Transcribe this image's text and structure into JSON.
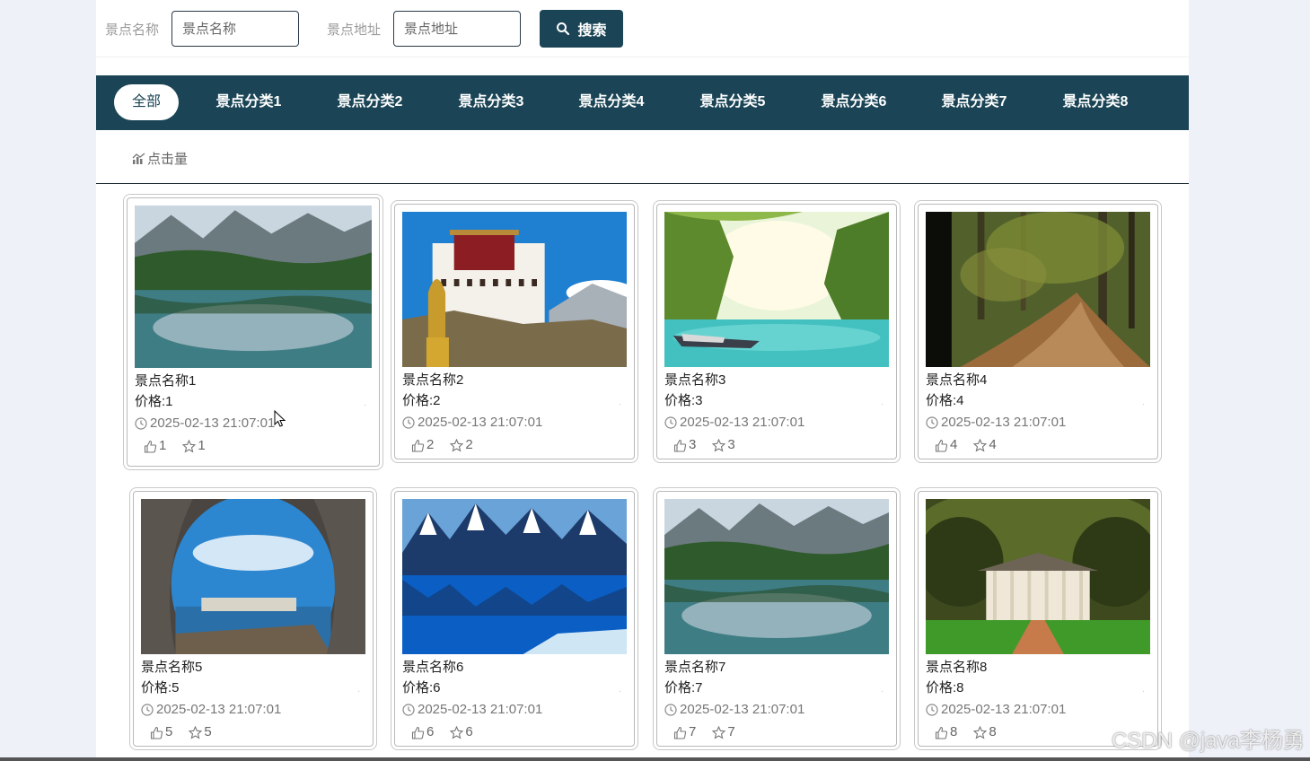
{
  "search": {
    "name_label": "景点名称",
    "name_placeholder": "景点名称",
    "address_label": "景点地址",
    "address_placeholder": "景点地址",
    "button_label": "搜索"
  },
  "categories": [
    "全部",
    "景点分类1",
    "景点分类2",
    "景点分类3",
    "景点分类4",
    "景点分类5",
    "景点分类6",
    "景点分类7",
    "景点分类8"
  ],
  "sort": {
    "label": "点击量"
  },
  "cards": [
    {
      "title": "景点名称1",
      "price": "价格:1",
      "time": "2025-02-13 21:07:01",
      "likes": "1",
      "favorites": "1",
      "scene": "lake"
    },
    {
      "title": "景点名称2",
      "price": "价格:2",
      "time": "2025-02-13 21:07:01",
      "likes": "2",
      "favorites": "2",
      "scene": "palace"
    },
    {
      "title": "景点名称3",
      "price": "价格:3",
      "time": "2025-02-13 21:07:01",
      "likes": "3",
      "favorites": "3",
      "scene": "river"
    },
    {
      "title": "景点名称4",
      "price": "价格:4",
      "time": "2025-02-13 21:07:01",
      "likes": "4",
      "favorites": "4",
      "scene": "forest"
    },
    {
      "title": "景点名称5",
      "price": "价格:5",
      "time": "2025-02-13 21:07:01",
      "likes": "5",
      "favorites": "5",
      "scene": "arch"
    },
    {
      "title": "景点名称6",
      "price": "价格:6",
      "time": "2025-02-13 21:07:01",
      "likes": "6",
      "favorites": "6",
      "scene": "snow"
    },
    {
      "title": "景点名称7",
      "price": "价格:7",
      "time": "2025-02-13 21:07:01",
      "likes": "7",
      "favorites": "7",
      "scene": "lake"
    },
    {
      "title": "景点名称8",
      "price": "价格:8",
      "time": "2025-02-13 21:07:01",
      "likes": "8",
      "favorites": "8",
      "scene": "mansion"
    }
  ],
  "watermark": "CSDN @java李杨勇",
  "colors": {
    "primary": "#1b4556",
    "page_bg": "#eef1f8"
  }
}
